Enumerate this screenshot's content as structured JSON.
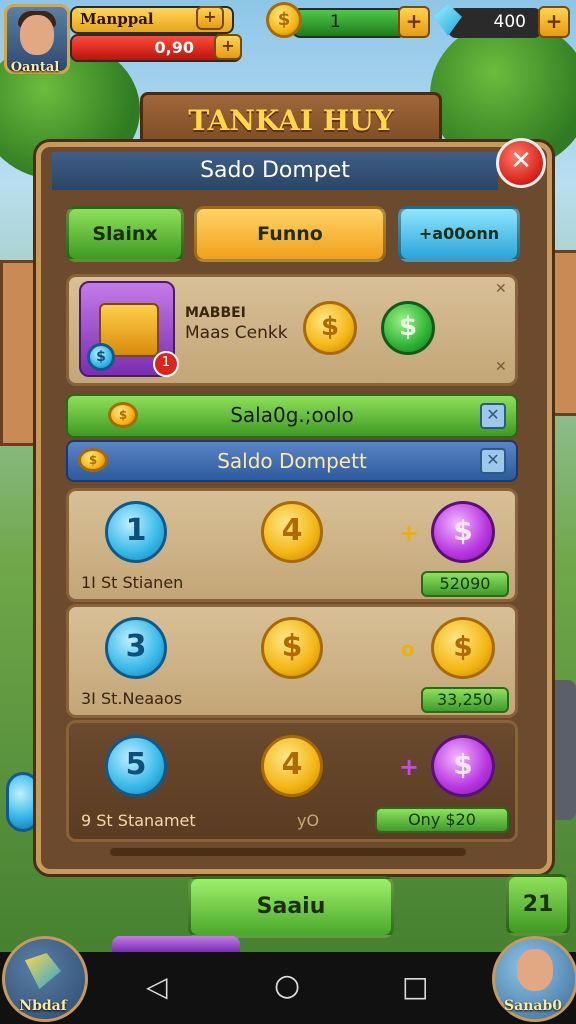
{
  "player": {
    "name_top": "Manppal",
    "name_bottom": "Oantal",
    "hp_value": "0,90",
    "plus": "+",
    "coins": "1",
    "gems": "400"
  },
  "panel": {
    "banner_title": "TANKAI HUY",
    "subtitle": "Sado Dompet",
    "close_label": "✕"
  },
  "tabs": [
    {
      "label": "Slainx"
    },
    {
      "label": "Funno"
    },
    {
      "label": "+a00onn"
    }
  ],
  "feature_card": {
    "line1": "MABBEI",
    "line2": "Maas Cenkk",
    "badge": "1",
    "gold_coin": "$",
    "green_coin": "$"
  },
  "strip_green": {
    "label": "Sala0g.;oolo"
  },
  "strip_blue": {
    "label": "Saldo Dompett"
  },
  "rows": [
    {
      "coin_left": "1",
      "coin_mid": "4",
      "op": "+",
      "coin_right": "$",
      "label": "1I St Stianen",
      "value": "52090"
    },
    {
      "coin_left": "3",
      "coin_mid": "$",
      "op": "o",
      "coin_right": "$",
      "label": "3I St.Neaaos",
      "value": "33,250"
    },
    {
      "coin_left": "5",
      "coin_mid": "4",
      "op": "+",
      "coin_right": "$",
      "label": "9 St Stanamet",
      "value": "Ony $20",
      "mid_note": "yO"
    }
  ],
  "actions": {
    "main_button": "Saaiu",
    "side_button": "21"
  },
  "bottom": {
    "left_label": "Nbdaf",
    "right_label": "Sanab0"
  },
  "nav": {
    "back_icon": "◁",
    "home_icon": "○",
    "recent_icon": "□"
  }
}
